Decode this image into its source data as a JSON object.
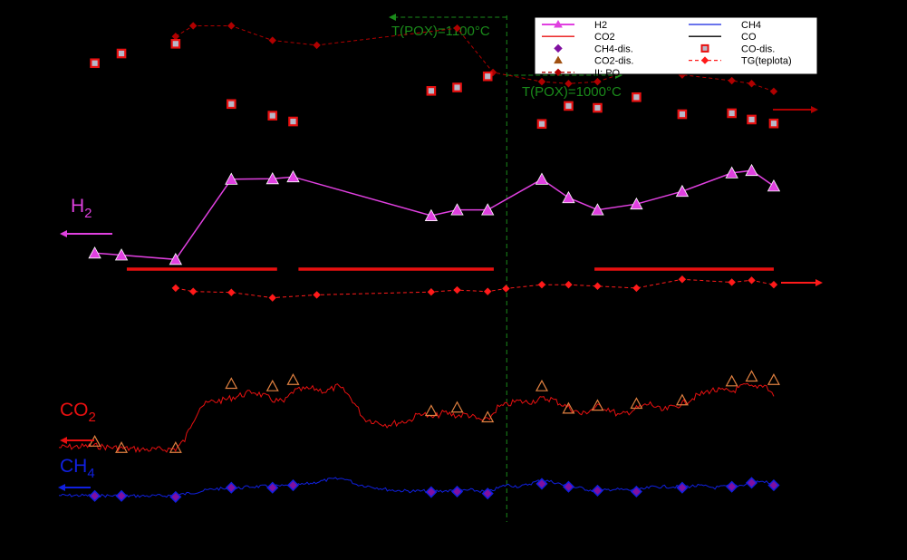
{
  "chart_data": {
    "type": "line",
    "xlim": [
      0,
      100
    ],
    "ylim_left": [
      0,
      100
    ],
    "ylim_right": [
      0,
      100
    ],
    "grid": false,
    "legend_position": "top-right",
    "colors": {
      "background": "#000000",
      "h2": "#e040e0",
      "co2": "#e81010",
      "ch4": "#1020e0",
      "co": "#000000",
      "temperature": "#ff1a1a",
      "pox": "#b00000",
      "co_dis_face": "#b8b8c8",
      "co_dis_edge": "#e81010",
      "co2_dis_edge": "#e08040",
      "ch4_dis_face": "#8010a0",
      "annotation": "#1a8a1a"
    },
    "legend": [
      {
        "label": "H2",
        "symbol": "line-triangle",
        "color": "#e040e0"
      },
      {
        "label": "CH4",
        "symbol": "line",
        "color": "#1020e0"
      },
      {
        "label": "CO2",
        "symbol": "line",
        "color": "#e81010"
      },
      {
        "label": "CO",
        "symbol": "line",
        "color": "#000000"
      },
      {
        "label": "CH4-dis.",
        "symbol": "diamond",
        "color": "#8010a0"
      },
      {
        "label": "CO-dis.",
        "symbol": "square",
        "color": "#e81010"
      },
      {
        "label": "CO2-dis.",
        "symbol": "triangle",
        "color": "#a05010"
      },
      {
        "label": "TG(teplota)",
        "symbol": "dashed-diamond",
        "color": "#ff1a1a"
      },
      {
        "label": "II: PO",
        "symbol": "dashed-diamond",
        "color": "#b00000"
      }
    ],
    "annotations": {
      "pox_1100": "T(POX)=1100°C",
      "pox_1000": "T(POX)=1000°C",
      "divider_x": 58.7
    },
    "series_labels": [
      {
        "key": "h2",
        "text": "H",
        "sub": "2"
      },
      {
        "key": "co2",
        "text": "CO",
        "sub": "2"
      },
      {
        "key": "ch4",
        "text": "CH",
        "sub": "4"
      }
    ],
    "series": [
      {
        "name": "H2",
        "kind": "line-markers",
        "axis": "left",
        "x": [
          4.7,
          8.2,
          15.3,
          22.6,
          28.0,
          30.7,
          48.8,
          52.2,
          56.2,
          63.3,
          66.8,
          70.6,
          75.7,
          81.7,
          88.2,
          90.8,
          93.7
        ],
        "values": [
          50.5,
          50.1,
          49.2,
          65.7,
          65.8,
          66.2,
          58.2,
          59.4,
          59.4,
          65.7,
          61.9,
          59.4,
          60.6,
          63.2,
          67.0,
          67.5,
          64.3
        ]
      },
      {
        "name": "CO",
        "kind": "line",
        "axis": "right",
        "color": "#e81010",
        "segments": [
          {
            "x": [
              8.9,
              28.6
            ],
            "values": [
              47.2,
              47.2
            ]
          },
          {
            "x": [
              31.4,
              57.0
            ],
            "values": [
              47.2,
              47.2
            ]
          },
          {
            "x": [
              70.2,
              93.7
            ],
            "values": [
              47.2,
              47.2
            ]
          }
        ]
      },
      {
        "name": "TG(teplota)",
        "kind": "dashed-markers",
        "axis": "right",
        "x": [
          15.3,
          17.6,
          22.6,
          28.0,
          33.8,
          48.8,
          52.2,
          56.2,
          58.6,
          63.3,
          66.8,
          70.6,
          75.7,
          81.7,
          88.2,
          90.8,
          93.7
        ],
        "values": [
          43.3,
          42.6,
          42.4,
          41.3,
          41.9,
          42.5,
          42.9,
          42.6,
          43.2,
          44.0,
          44.0,
          43.7,
          43.3,
          45.1,
          44.5,
          44.9,
          44.0
        ]
      },
      {
        "name": "II: PO",
        "kind": "dashed-markers",
        "axis": "right",
        "x": [
          15.3,
          17.6,
          22.6,
          28.0,
          33.8,
          52.2,
          56.9,
          63.3,
          66.8,
          70.6,
          75.7,
          81.7,
          88.2,
          90.8,
          93.7
        ],
        "values": [
          95.1,
          97.3,
          97.3,
          94.3,
          93.3,
          96.8,
          87.7,
          85.8,
          85.4,
          85.8,
          88.4,
          87.2,
          86.0,
          85.4,
          83.8
        ]
      },
      {
        "name": "CO-dis.",
        "kind": "markers",
        "axis": "left",
        "x": [
          4.7,
          8.2,
          15.3,
          22.6,
          28.0,
          30.7,
          48.8,
          52.2,
          56.2,
          63.3,
          66.8,
          70.6,
          75.7,
          81.7,
          88.2,
          90.8,
          93.7
        ],
        "values": [
          89.6,
          91.6,
          93.6,
          81.2,
          78.8,
          77.6,
          83.9,
          84.6,
          86.9,
          77.1,
          80.8,
          80.4,
          82.6,
          79.1,
          79.3,
          78.0,
          77.2
        ]
      },
      {
        "name": "CO2",
        "kind": "line",
        "axis": "left",
        "x": [
          0,
          4.7,
          8.2,
          12.0,
          15.3,
          16.5,
          17.5,
          18.5,
          20.0,
          21.5,
          22.6,
          24.0,
          25.5,
          27.0,
          28.0,
          29.5,
          30.7,
          32.0,
          33.5,
          35.0,
          36.5,
          37.5,
          38.5,
          40.0,
          41.5,
          43.0,
          44.5,
          46.0,
          47.5,
          48.8,
          50.5,
          52.2,
          53.5,
          55.0,
          56.2,
          57.5,
          58.7,
          60.0,
          61.5,
          63.3,
          64.5,
          66.8,
          68.5,
          70.6,
          72.0,
          73.5,
          75.7,
          77.5,
          79.0,
          81.7,
          83.5,
          85.5,
          88.2,
          90.0,
          90.8,
          92.5,
          93.7
        ],
        "values": [
          10.5,
          10.8,
          10.3,
          10.0,
          10.2,
          12.0,
          15.8,
          18.9,
          19.9,
          20.2,
          20.7,
          21.3,
          22.0,
          21.0,
          20.3,
          19.8,
          22.0,
          22.4,
          22.6,
          22.0,
          23.0,
          22.0,
          20.2,
          16.4,
          15.8,
          15.2,
          15.6,
          16.1,
          17.7,
          16.5,
          17.7,
          17.0,
          17.3,
          16.2,
          16.0,
          18.7,
          19.2,
          20.0,
          19.8,
          20.5,
          20.5,
          18.7,
          17.3,
          18.9,
          18.5,
          17.0,
          18.5,
          19.5,
          18.0,
          19.5,
          21.0,
          22.3,
          22.0,
          23.3,
          22.8,
          23.5,
          21.0
        ]
      },
      {
        "name": "CO2-dis.",
        "kind": "markers",
        "axis": "left",
        "x": [
          4.7,
          8.2,
          15.3,
          22.6,
          28.0,
          30.7,
          48.8,
          52.2,
          56.2,
          63.3,
          66.8,
          70.6,
          75.7,
          81.7,
          88.2,
          90.8,
          93.7
        ],
        "values": [
          11.7,
          10.4,
          10.4,
          23.6,
          23.1,
          24.4,
          18.0,
          18.7,
          16.7,
          23.1,
          18.5,
          19.1,
          19.5,
          20.2,
          24.1,
          25.1,
          24.4
        ]
      },
      {
        "name": "CH4",
        "kind": "line",
        "axis": "left",
        "x": [
          0,
          4.7,
          8.2,
          12.0,
          15.3,
          18.0,
          20.5,
          22.6,
          25.0,
          28.0,
          30.7,
          33.0,
          35.5,
          37.5,
          39.0,
          41.0,
          43.5,
          46.0,
          48.8,
          52.2,
          54.0,
          56.2,
          58.7,
          60.5,
          63.3,
          65.0,
          66.8,
          68.5,
          70.6,
          72.5,
          75.7,
          78.0,
          81.7,
          84.0,
          86.0,
          88.2,
          89.5,
          90.8,
          92.5,
          93.7
        ],
        "values": [
          0.6,
          0.6,
          0.5,
          0.5,
          0.6,
          1.3,
          2.0,
          1.9,
          2.4,
          2.5,
          2.6,
          3.1,
          3.9,
          4.1,
          2.9,
          2.4,
          1.7,
          1.5,
          1.5,
          1.6,
          1.7,
          1.3,
          2.8,
          2.4,
          3.8,
          3.3,
          2.4,
          2.1,
          1.4,
          1.9,
          1.6,
          2.4,
          2.4,
          2.6,
          2.2,
          2.6,
          2.7,
          3.4,
          3.5,
          2.6
        ]
      },
      {
        "name": "CH4-dis.",
        "kind": "markers",
        "axis": "left",
        "x": [
          4.7,
          8.2,
          15.3,
          22.6,
          28.0,
          30.7,
          48.8,
          52.2,
          56.2,
          63.3,
          66.8,
          70.6,
          75.7,
          81.7,
          88.2,
          90.8,
          93.7
        ],
        "values": [
          0.5,
          0.5,
          0.3,
          2.2,
          2.2,
          2.7,
          1.3,
          1.4,
          1.0,
          3.0,
          2.4,
          1.6,
          1.4,
          2.2,
          2.4,
          3.2,
          2.7
        ]
      }
    ]
  }
}
